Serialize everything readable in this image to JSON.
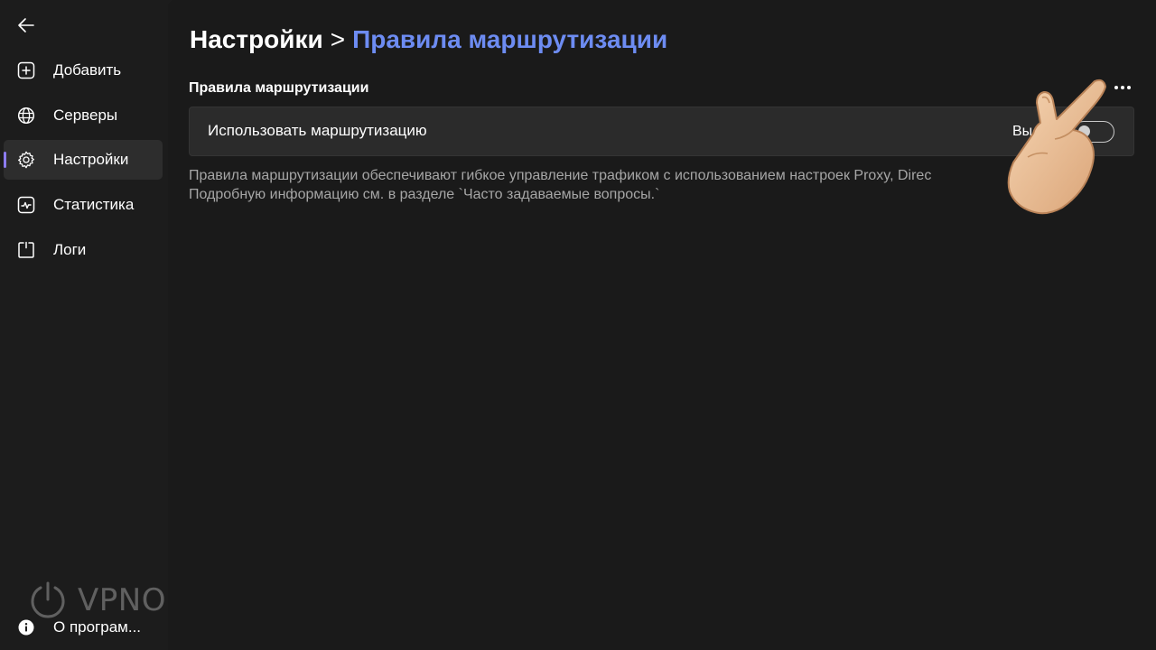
{
  "sidebar": {
    "back_icon": "arrow-left-icon",
    "items": [
      {
        "label": "Добавить",
        "icon": "add-square-icon",
        "active": false
      },
      {
        "label": "Серверы",
        "icon": "globe-icon",
        "active": false
      },
      {
        "label": "Настройки",
        "icon": "gear-icon",
        "active": true
      },
      {
        "label": "Статистика",
        "icon": "chart-icon",
        "active": false
      },
      {
        "label": "Логи",
        "icon": "log-icon",
        "active": false
      }
    ],
    "logo_text": "VPNON",
    "about": {
      "label": "О програм...",
      "icon": "info-icon"
    }
  },
  "header": {
    "breadcrumb_root": "Настройки",
    "breadcrumb_separator": ">",
    "breadcrumb_current": "Правила маршрутизации"
  },
  "section": {
    "title": "Правила маршрутизации",
    "more_icon": "more-horizontal-icon"
  },
  "routing_toggle": {
    "label": "Использовать маршрутизацию",
    "state_label": "Вы",
    "is_on": false
  },
  "description": {
    "line1": "Правила маршрутизации обеспечивают гибкое управление трафиком с использованием настроек Proxy, Direc",
    "line2": "Подробную информацию см. в разделе `Часто задаваемые вопросы.`"
  },
  "colors": {
    "accent": "#8c7cf0",
    "breadcrumb_current": "#6d8cf2",
    "background": "#1a1a1a",
    "card": "#2b2b2b",
    "muted_text": "#a6a6a6"
  },
  "overlay": {
    "icon": "pointing-hand-icon"
  }
}
